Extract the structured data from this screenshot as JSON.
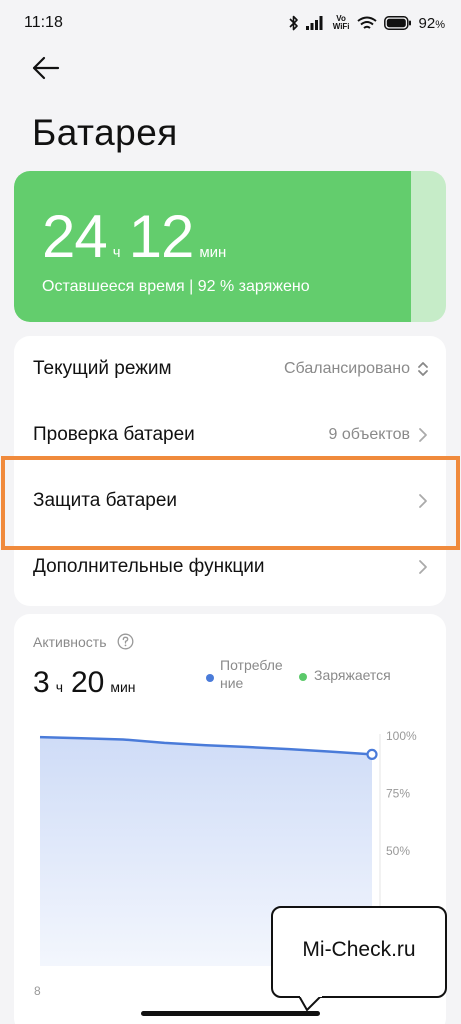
{
  "status_bar": {
    "time": "11:18",
    "battery_percent": "92",
    "battery_symbol": "%",
    "vowifi_top": "Vo",
    "vowifi_bottom": "WiFi",
    "icons": [
      "bluetooth-icon",
      "signal-icon",
      "vowifi-icon",
      "wifi-icon",
      "battery-icon"
    ]
  },
  "header": {
    "back_icon": "arrow-left-icon",
    "title": "Батарея"
  },
  "battery_card": {
    "hours": "24",
    "hours_unit": "ч",
    "minutes": "12",
    "minutes_unit": "мин",
    "subtitle": "Оставшееся время | 92 % заряжено",
    "charge_level": 0.92,
    "fill_color": "#63cd6d",
    "track_color": "#c6ecc8"
  },
  "settings": {
    "items": [
      {
        "label": "Текущий режим",
        "value": "Сбалансировано",
        "icon": "up-down-chevron-icon"
      },
      {
        "label": "Проверка батареи",
        "value": "9 объектов",
        "icon": "chevron-right-icon"
      },
      {
        "label": "Защита батареи",
        "value": "",
        "icon": "chevron-right-icon"
      },
      {
        "label": "Дополнительные функции",
        "value": "",
        "icon": "chevron-right-icon"
      }
    ],
    "highlight_color": "#f08a3c"
  },
  "activity": {
    "label": "Активность",
    "help_icon": "question-circle-icon",
    "hours": "3",
    "hours_unit": "ч",
    "minutes": "20",
    "minutes_unit": "мин",
    "legend": [
      {
        "name": "Потребле\nние",
        "color": "#4a7bd9"
      },
      {
        "name": "Заряжается",
        "color": "#5bc96a"
      }
    ],
    "axis_bottom_label": "8"
  },
  "chart_data": {
    "type": "area",
    "y_ticks": [
      "100%",
      "75%",
      "50%"
    ],
    "ylim": [
      0,
      100
    ],
    "x": [
      0,
      1,
      2,
      3,
      4,
      5,
      6,
      7,
      8
    ],
    "values": [
      99.5,
      99.0,
      98.5,
      97.0,
      96.0,
      95.2,
      94.3,
      93.2,
      92
    ],
    "line_color": "#4a7bd9",
    "fill_color": "#cfdcf7"
  },
  "watermark": {
    "text": "Mi-Check.ru"
  }
}
